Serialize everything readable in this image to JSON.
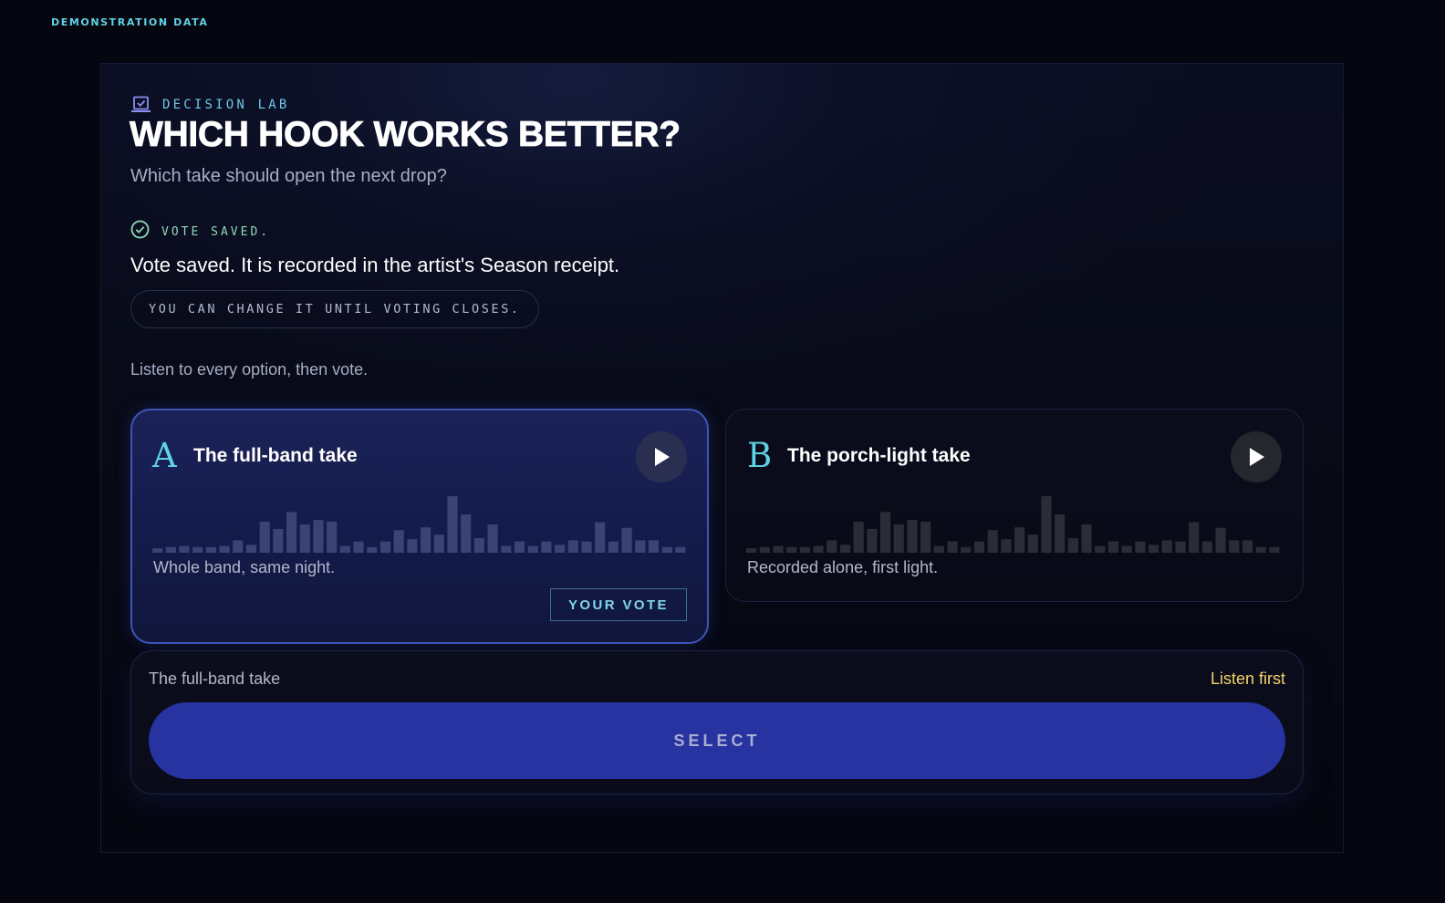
{
  "demo_tag": "DEMONSTRATION DATA",
  "header": {
    "eyebrow": "DECISION LAB",
    "title": "WHICH HOOK WORKS BETTER?",
    "subtitle": "Which take should open the next drop?"
  },
  "status": {
    "label": "VOTE SAVED.",
    "message": "Vote saved. It is recorded in the artist's Season receipt.",
    "change_note": "YOU CAN CHANGE IT UNTIL VOTING CLOSES."
  },
  "instructions": "Listen to every option, then vote.",
  "options": [
    {
      "letter": "A",
      "title": "The full-band take",
      "description": "Whole band, same night.",
      "selected": true,
      "vote_badge": "YOUR VOTE",
      "waveform": [
        0.08,
        0.1,
        0.12,
        0.1,
        0.1,
        0.12,
        0.22,
        0.14,
        0.55,
        0.42,
        0.72,
        0.5,
        0.58,
        0.55,
        0.12,
        0.2,
        0.1,
        0.2,
        0.4,
        0.24,
        0.45,
        0.32,
        1.0,
        0.68,
        0.26,
        0.5,
        0.12,
        0.2,
        0.12,
        0.2,
        0.14,
        0.22,
        0.2,
        0.54,
        0.2,
        0.44,
        0.22,
        0.22,
        0.1,
        0.1
      ]
    },
    {
      "letter": "B",
      "title": "The porch-light take",
      "description": "Recorded alone, first light.",
      "selected": false,
      "waveform": [
        0.08,
        0.1,
        0.12,
        0.1,
        0.1,
        0.12,
        0.22,
        0.14,
        0.55,
        0.42,
        0.72,
        0.5,
        0.58,
        0.55,
        0.12,
        0.2,
        0.1,
        0.2,
        0.4,
        0.24,
        0.45,
        0.32,
        1.0,
        0.68,
        0.26,
        0.5,
        0.12,
        0.2,
        0.12,
        0.2,
        0.14,
        0.22,
        0.2,
        0.54,
        0.2,
        0.44,
        0.22,
        0.22,
        0.1,
        0.1
      ]
    }
  ],
  "footer": {
    "selected_name": "The full-band take",
    "hint": "Listen first",
    "select_label": "SELECT"
  },
  "colors": {
    "accent_cyan": "#5fd3e6",
    "selected_card": "#1b2258",
    "select_button": "#2633a0",
    "hint_yellow": "#f2d26a",
    "success_green": "#8fd9b6"
  },
  "icons": {
    "eyebrow": "ballot-check-icon",
    "status": "check-circle-icon",
    "play": "play-icon"
  }
}
